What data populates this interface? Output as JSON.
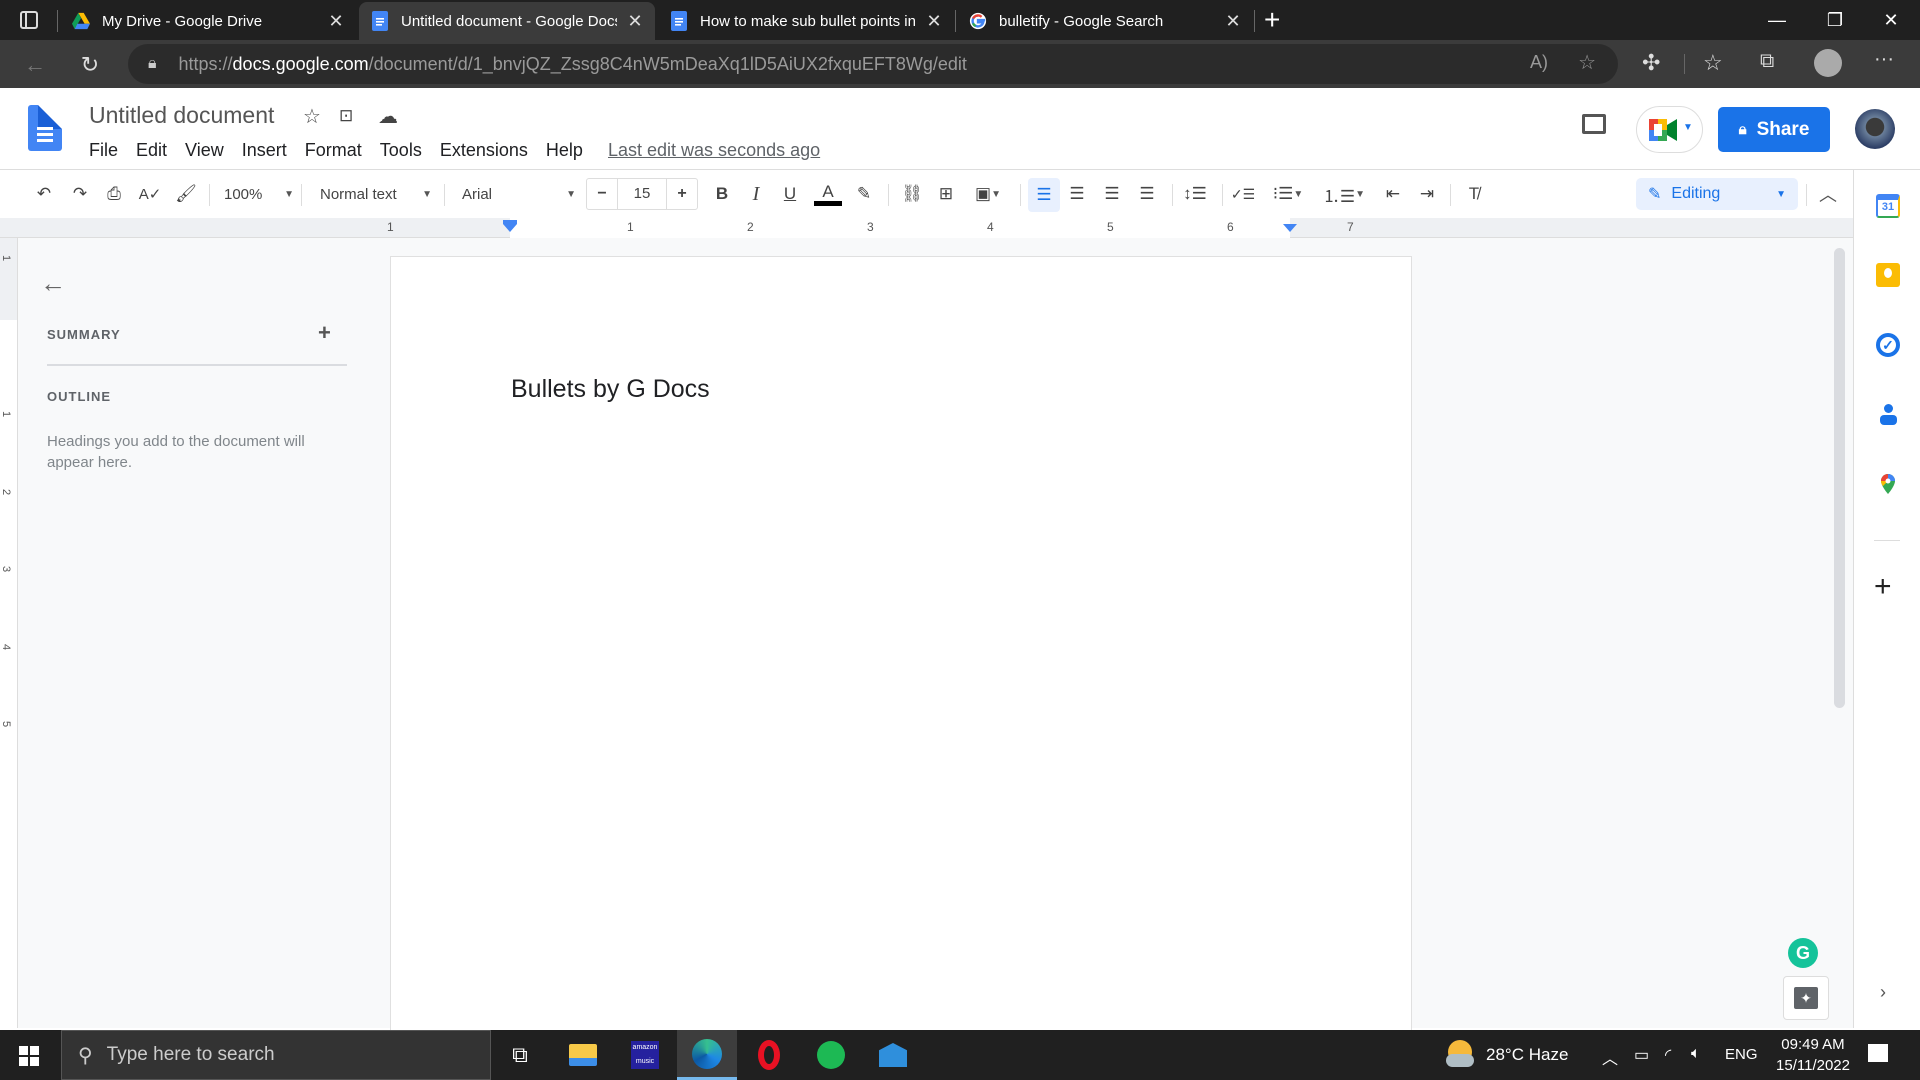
{
  "browser": {
    "tabs": [
      {
        "title": "My Drive - Google Drive",
        "icon": "google-drive-icon",
        "active": false
      },
      {
        "title": "Untitled document - Google Docs",
        "icon": "google-docs-icon",
        "active": true
      },
      {
        "title": "How to make sub bullet points in Google Docs",
        "icon": "google-docs-icon",
        "active": false
      },
      {
        "title": "bulletify - Google Search",
        "icon": "google-icon",
        "active": false
      }
    ],
    "close_glyph": "✕",
    "new_tab_glyph": "+",
    "url_prefix": "https://",
    "url_domain": "docs.google.com",
    "url_path": "/document/d/1_bnvjQZ_Zssg8C4nW5mDeaXq1lD5AiUX2fxquEFT8Wg/edit",
    "window_controls": {
      "minimize": "—",
      "restore": "❐",
      "close": "✕"
    }
  },
  "docs": {
    "title": "Untitled document",
    "menu": [
      "File",
      "Edit",
      "View",
      "Insert",
      "Format",
      "Tools",
      "Extensions",
      "Help"
    ],
    "last_edit": "Last edit was seconds ago",
    "share_label": "Share",
    "toolbar": {
      "zoom": "100%",
      "style": "Normal text",
      "font": "Arial",
      "font_size": "15",
      "bold": "B",
      "italic": "I",
      "underline": "U",
      "text_color": "A",
      "text_color_value": "#000000",
      "mode": "Editing",
      "minus": "−",
      "plus": "+"
    },
    "ruler_numbers": [
      "1",
      "1",
      "2",
      "3",
      "4",
      "5",
      "6",
      "7"
    ],
    "vruler_numbers": [
      "1",
      "1",
      "2",
      "3",
      "4",
      "5"
    ],
    "side_panel": {
      "summary_label": "SUMMARY",
      "outline_label": "OUTLINE",
      "outline_hint": "Headings you add to the document will appear here."
    },
    "document_text": "Bullets by G Docs",
    "accent": "#1a73e8"
  },
  "taskbar": {
    "search_placeholder": "Type here to search",
    "weather": "28°C  Haze",
    "language": "ENG",
    "time": "09:49 AM",
    "date": "15/11/2022"
  }
}
